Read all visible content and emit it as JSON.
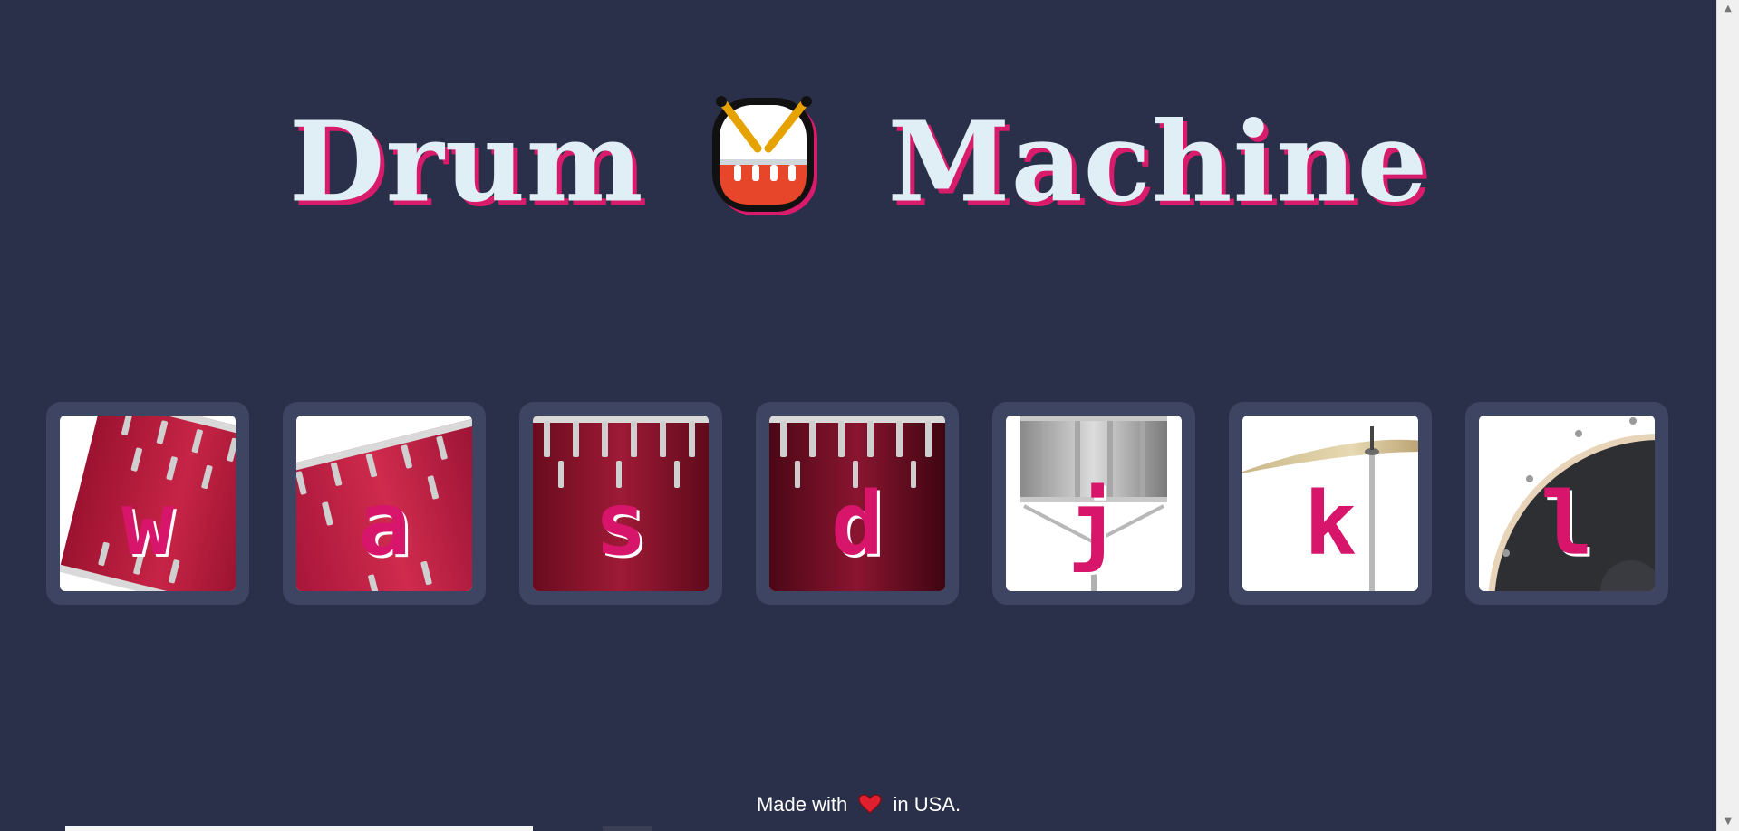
{
  "header": {
    "title_left": "Drum",
    "title_right": "Machine",
    "emoji_icon": "drum-icon"
  },
  "pads": [
    {
      "key": "w",
      "art": "tom-tilted-left"
    },
    {
      "key": "a",
      "art": "tom-tilted-right"
    },
    {
      "key": "s",
      "art": "snare-dark-red"
    },
    {
      "key": "d",
      "art": "floor-tom-dark"
    },
    {
      "key": "j",
      "art": "snare-silver-stand"
    },
    {
      "key": "k",
      "art": "cymbal"
    },
    {
      "key": "l",
      "art": "bass-drum"
    }
  ],
  "footer": {
    "made_with": "Made with",
    "location": "in USA.",
    "heart_icon": "heart-icon"
  },
  "colors": {
    "background": "#2a3049",
    "pad_frame": "#3d4562",
    "title_text": "#e0eef6",
    "accent": "#d81b6a"
  }
}
